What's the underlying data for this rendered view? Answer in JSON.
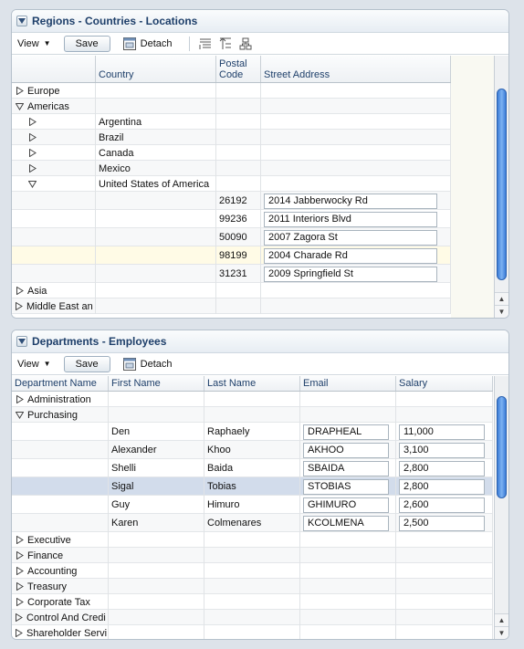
{
  "panel1": {
    "title": "Regions - Countries - Locations",
    "toolbar": {
      "view_label": "View",
      "save_label": "Save",
      "detach_label": "Detach"
    },
    "columns": [
      "",
      "Country",
      "Postal Code",
      "Street Address"
    ],
    "rows": [
      {
        "region": "Europe",
        "disc": "collapsed",
        "level": 0
      },
      {
        "region": "Americas",
        "disc": "expanded",
        "level": 0
      },
      {
        "country": "Argentina",
        "disc": "collapsed",
        "level": 1
      },
      {
        "country": "Brazil",
        "disc": "collapsed",
        "level": 1
      },
      {
        "country": "Canada",
        "disc": "collapsed",
        "level": 1
      },
      {
        "country": "Mexico",
        "disc": "collapsed",
        "level": 1
      },
      {
        "country": "United States of America",
        "disc": "expanded",
        "level": 1
      },
      {
        "postal": "26192",
        "street": "2014 Jabberwocky Rd",
        "level": 2
      },
      {
        "postal": "99236",
        "street": "2011 Interiors Blvd",
        "level": 2
      },
      {
        "postal": "50090",
        "street": "2007 Zagora St",
        "level": 2
      },
      {
        "postal": "98199",
        "street": "2004 Charade Rd",
        "level": 2,
        "highlight": true
      },
      {
        "postal": "31231",
        "street": "2009 Springfield St",
        "level": 2
      },
      {
        "region": "Asia",
        "disc": "collapsed",
        "level": 0
      },
      {
        "region": "Middle East an",
        "disc": "collapsed",
        "level": 0
      }
    ]
  },
  "panel2": {
    "title": "Departments - Employees",
    "toolbar": {
      "view_label": "View",
      "save_label": "Save",
      "detach_label": "Detach"
    },
    "columns": [
      "Department Name",
      "First Name",
      "Last Name",
      "Email",
      "Salary"
    ],
    "rows": [
      {
        "dept": "Administration",
        "disc": "collapsed",
        "level": 0
      },
      {
        "dept": "Purchasing",
        "disc": "expanded",
        "level": 0
      },
      {
        "first": "Den",
        "last": "Raphaely",
        "email": "DRAPHEAL",
        "salary": "11,000",
        "level": 1
      },
      {
        "first": "Alexander",
        "last": "Khoo",
        "email": "AKHOO",
        "salary": "3,100",
        "level": 1
      },
      {
        "first": "Shelli",
        "last": "Baida",
        "email": "SBAIDA",
        "salary": "2,800",
        "level": 1
      },
      {
        "first": "Sigal",
        "last": "Tobias",
        "email": "STOBIAS",
        "salary": "2,800",
        "level": 1,
        "selected": true
      },
      {
        "first": "Guy",
        "last": "Himuro",
        "email": "GHIMURO",
        "salary": "2,600",
        "level": 1
      },
      {
        "first": "Karen",
        "last": "Colmenares",
        "email": "KCOLMENA",
        "salary": "2,500",
        "level": 1
      },
      {
        "dept": "Executive",
        "disc": "collapsed",
        "level": 0
      },
      {
        "dept": "Finance",
        "disc": "collapsed",
        "level": 0
      },
      {
        "dept": "Accounting",
        "disc": "collapsed",
        "level": 0
      },
      {
        "dept": "Treasury",
        "disc": "collapsed",
        "level": 0
      },
      {
        "dept": "Corporate Tax",
        "disc": "collapsed",
        "level": 0
      },
      {
        "dept": "Control And Credi",
        "disc": "collapsed",
        "level": 0
      },
      {
        "dept": "Shareholder Servi",
        "disc": "collapsed",
        "level": 0
      }
    ]
  }
}
